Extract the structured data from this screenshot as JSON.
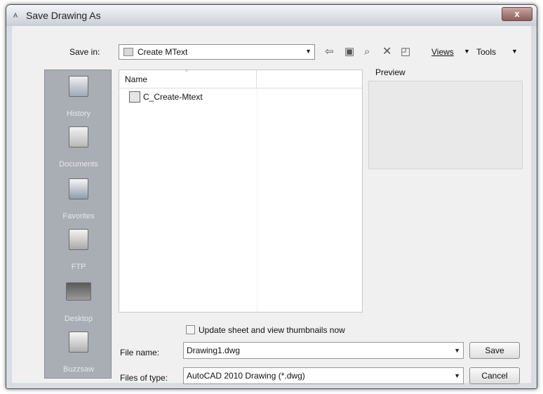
{
  "window": {
    "title": "Save Drawing As",
    "close_label": "x"
  },
  "save_in": {
    "label": "Save in:",
    "value": "Create MText"
  },
  "toolbar": {
    "views_label": "Views",
    "tools_label": "Tools"
  },
  "places": [
    {
      "label": "History"
    },
    {
      "label": "Documents"
    },
    {
      "label": "Favorites"
    },
    {
      "label": "FTP"
    },
    {
      "label": "Desktop"
    },
    {
      "label": "Buzzsaw"
    }
  ],
  "file_list": {
    "column_name": "Name",
    "items": [
      {
        "name": "C_Create-Mtext"
      }
    ]
  },
  "preview": {
    "label": "Preview"
  },
  "thumbnails_checkbox": {
    "label": "Update sheet and view thumbnails now",
    "checked": false
  },
  "file_name": {
    "label": "File name:",
    "value": "Drawing1.dwg"
  },
  "file_type": {
    "label": "Files of type:",
    "value": "AutoCAD 2010 Drawing (*.dwg)"
  },
  "buttons": {
    "save": "Save",
    "cancel": "Cancel"
  }
}
